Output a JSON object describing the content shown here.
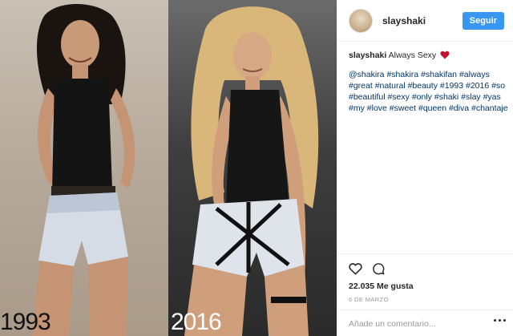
{
  "photos": {
    "left": {
      "year": "1993"
    },
    "right": {
      "year": "2016"
    }
  },
  "header": {
    "username": "slayshaki",
    "follow_label": "Seguir"
  },
  "caption": {
    "username": "slayshaki",
    "text": "Always Sexy",
    "emoji": "heart-icon"
  },
  "hashtags": [
    "@shakira",
    "#shakira",
    "#shakifan",
    "#always",
    "#great",
    "#natural",
    "#beauty",
    "#1993",
    "#2016",
    "#so",
    "#beautiful",
    "#sexy",
    "#only",
    "#shaki",
    "#slay",
    "#yas",
    "#my",
    "#love",
    "#sweet",
    "#queen",
    "#diva",
    "#chantaje"
  ],
  "actions": {
    "likes": "22.035 Me gusta",
    "date": "6 DE MARZO"
  },
  "comment": {
    "placeholder": "Añade un comentario..."
  },
  "colors": {
    "accent": "#3897f0",
    "hashtag": "#003569",
    "heart": "#c0152f"
  }
}
